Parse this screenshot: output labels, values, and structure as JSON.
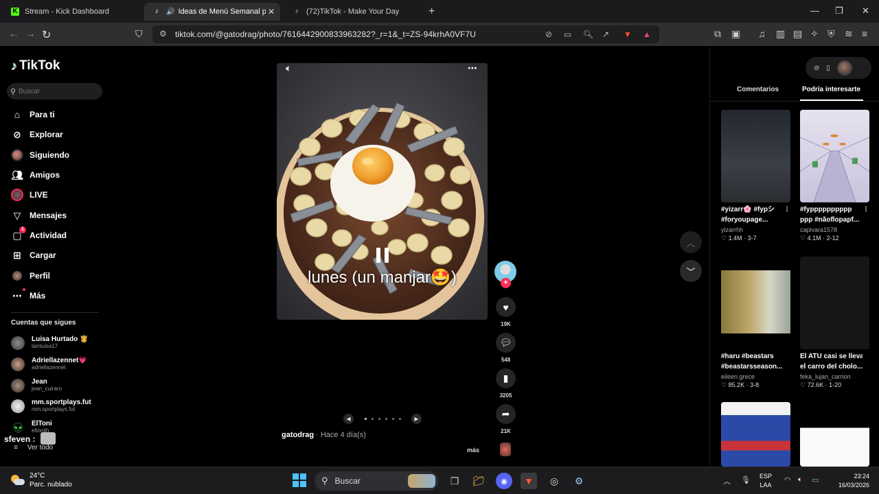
{
  "browser": {
    "tabs": [
      {
        "title": "Stream - Kick Dashboard",
        "favicon": "K"
      },
      {
        "title": "Ideas de Menú Semanal para",
        "favicon": "tiktok",
        "active": true
      },
      {
        "title": "(72)TikTok - Make Your Day",
        "favicon": "tiktok"
      }
    ],
    "url": "tiktok.com/@gatodrag/photo/7616442900833963282?_r=1&_t=ZS-94krhA0VF7U"
  },
  "sidebar": {
    "logo": "TikTok",
    "search_placeholder": "Buscar",
    "nav": [
      {
        "label": "Para ti",
        "icon": "home-icon"
      },
      {
        "label": "Explorar",
        "icon": "compass-icon"
      },
      {
        "label": "Siguiendo",
        "icon": "avatar"
      },
      {
        "label": "Amigos",
        "icon": "friends-icon"
      },
      {
        "label": "LIVE",
        "icon": "live-icon"
      },
      {
        "label": "Mensajes",
        "icon": "messages-icon"
      },
      {
        "label": "Actividad",
        "icon": "activity-icon",
        "badge": "1"
      },
      {
        "label": "Cargar",
        "icon": "upload-icon"
      },
      {
        "label": "Perfil",
        "icon": "profile-avatar"
      },
      {
        "label": "Más",
        "icon": "more-icon"
      }
    ],
    "following_title": "Cuentas que sigues",
    "following": [
      {
        "name": "Luisa Hurtado",
        "suffix": "👸",
        "username": "lamluisa17"
      },
      {
        "name": "Adriellazennet",
        "suffix": "💗",
        "username": "adriellazennet"
      },
      {
        "name": "Jean",
        "suffix": "",
        "username": "jean_cuiraro"
      },
      {
        "name": "mm.sportplays.fut",
        "suffix": "",
        "username": "mm.sportplays.fut"
      },
      {
        "name": "ElToni",
        "suffix": "",
        "username": "eltonijh"
      }
    ],
    "see_all": "Ver todo",
    "overlay_name": "sfeven :"
  },
  "post": {
    "caption": "lunes (un manjar🤩)",
    "author": "gatodrag",
    "time_ago": "· Hace 4 día(s)",
    "more_link": "más",
    "carousel_dots": 6,
    "likes": "19K",
    "comments": "548",
    "saves": "3205",
    "shares": "21K"
  },
  "right_panel": {
    "tabs": [
      "Comentarios",
      "Podría interesarte"
    ],
    "active_tab": "Podría interesarte",
    "cards": [
      {
        "title_l1": "#yizarr🌸 #fypシ",
        "title_l2": "#foryoupage...",
        "author": "yizarrhh",
        "likes": "1.4M",
        "date": "3-7",
        "thumb": "dark-room"
      },
      {
        "title_l1": "#fypppppppppp",
        "title_l2": "ppp #nãoflopapf...",
        "author": "capivara1578",
        "likes": "4.1M",
        "date": "2-12",
        "thumb": "drawing"
      },
      {
        "title_l1": "#haru #beastars",
        "title_l2": "#beastarsseason...",
        "author": "eileen.grece",
        "likes": "85.2K",
        "date": "3-8",
        "thumb": "anime"
      },
      {
        "title_l1": "El ATU casi se lleva",
        "title_l2": "el carro del cholo...",
        "author": "feka_lujan_carrion",
        "likes": "72.6K",
        "date": "1-20",
        "thumb": "black"
      },
      {
        "title_l1": "",
        "title_l2": "",
        "author": "",
        "likes": "",
        "date": "",
        "thumb": "cosplay"
      },
      {
        "title_l1": "",
        "title_l2": "",
        "author": "",
        "likes": "",
        "date": "",
        "thumb": "white-notes"
      }
    ]
  },
  "taskbar": {
    "temp": "24°C",
    "weather": "Parc. nublado",
    "search": "Buscar",
    "lang_l1": "ESP",
    "lang_l2": "LAA",
    "time": "23:24",
    "date": "16/03/2026"
  }
}
